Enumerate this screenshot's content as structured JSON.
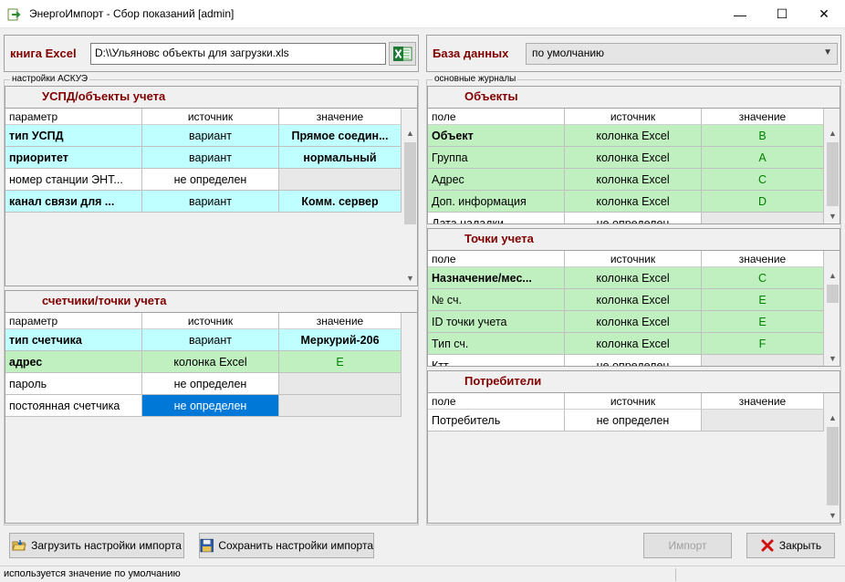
{
  "window": {
    "title": "ЭнергоИмпорт - Сбор показаний [admin]",
    "minimize": "—",
    "maximize": "☐",
    "close": "✕"
  },
  "excel": {
    "label": "книга Excel",
    "path": "D:\\\\Ульяновс объекты для загрузки.xls"
  },
  "database": {
    "label": "База данных",
    "value": "по умолчанию"
  },
  "askue": {
    "legend": "настройки АСКУЭ",
    "uspd": {
      "title": "УСПД/объекты учета",
      "headers": [
        "параметр",
        "источник",
        "значение"
      ],
      "rows": [
        {
          "param": "тип УСПД",
          "source": "вариант",
          "value": "Прямое соедин..."
        },
        {
          "param": "приоритет",
          "source": "вариант",
          "value": "нормальный"
        },
        {
          "param": "номер станции ЭНТ...",
          "source": "не определен",
          "value": ""
        },
        {
          "param": "канал связи для ...",
          "source": "вариант",
          "value": "Комм. сервер"
        }
      ]
    },
    "meters": {
      "title": "счетчики/точки учета",
      "headers": [
        "параметр",
        "источник",
        "значение"
      ],
      "rows": [
        {
          "param": "тип счетчика",
          "source": "вариант",
          "value": "Меркурий-206"
        },
        {
          "param": "адрес",
          "source": "колонка Excel",
          "value": "E"
        },
        {
          "param": "пароль",
          "source": "не определен",
          "value": ""
        },
        {
          "param": "постоянная счетчика",
          "source": "не определен",
          "value": ""
        }
      ]
    }
  },
  "journals": {
    "legend": "основные журналы",
    "objects": {
      "title": "Объекты",
      "headers": [
        "поле",
        "источник",
        "значение"
      ],
      "rows": [
        {
          "field": "Объект",
          "source": "колонка Excel",
          "value": "B"
        },
        {
          "field": "Группа",
          "source": "колонка Excel",
          "value": "A"
        },
        {
          "field": "Адрес",
          "source": "колонка Excel",
          "value": "C"
        },
        {
          "field": "Доп. информация",
          "source": "колонка Excel",
          "value": "D"
        },
        {
          "field": "Дата наладки",
          "source": "не определен",
          "value": ""
        }
      ]
    },
    "points": {
      "title": "Точки учета",
      "headers": [
        "поле",
        "источник",
        "значение"
      ],
      "rows": [
        {
          "field": "Назначение/мес...",
          "source": "колонка Excel",
          "value": "C"
        },
        {
          "field": "№ сч.",
          "source": "колонка Excel",
          "value": "E"
        },
        {
          "field": "ID точки учета",
          "source": "колонка Excel",
          "value": "E"
        },
        {
          "field": "Тип сч.",
          "source": "колонка Excel",
          "value": "F"
        },
        {
          "field": "Ктт",
          "source": "не определен",
          "value": ""
        }
      ]
    },
    "consumers": {
      "title": "Потребители",
      "headers": [
        "поле",
        "источник",
        "значение"
      ],
      "rows": [
        {
          "field": "Потребитель",
          "source": "не определен",
          "value": ""
        }
      ]
    }
  },
  "buttons": {
    "load": "Загрузить настройки импорта",
    "save": "Сохранить настройки импорта",
    "import": "Импорт",
    "close": "Закрыть"
  },
  "status": {
    "text": "используется значение по умолчанию"
  },
  "colors": {
    "accent_label": "#800000",
    "row_cyan": "#bfffff",
    "row_green": "#c0f0c0",
    "selection": "#0078d7",
    "value_green": "#008000"
  }
}
